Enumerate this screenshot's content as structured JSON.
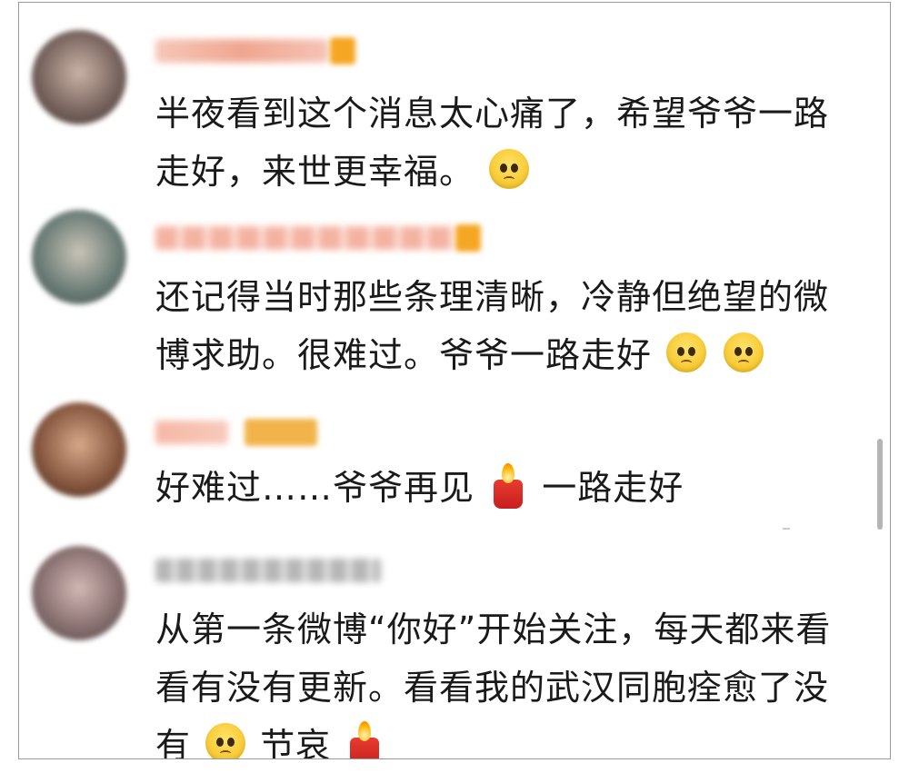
{
  "comments": [
    {
      "avatar_color": "#6b5a55",
      "username_color": "#f3b4a4",
      "text_lines": [
        "半夜看到这个消息太心痛了，希望爷爷一路",
        "走好，来世更幸福。"
      ],
      "trailing_icon": "pleading-face-icon"
    },
    {
      "avatar_color": "#7f8e8a",
      "username_color": "#f2a392",
      "text_lines": [
        "还记得当时那些条理清晰，冷静但绝望的微",
        "博求助。很难过。爷爷一路走好"
      ],
      "trailing_icons": [
        "pleading-face-icon",
        "pleading-face-icon"
      ]
    },
    {
      "avatar_color": "#8a6650",
      "username_color": "#f3a491",
      "text_before": "好难过……爷爷再见",
      "middle_icon": "candle-icon",
      "text_after": "一路走好"
    },
    {
      "avatar_color": "#8a7474",
      "username_color": "#a7a7a7",
      "text_lines": [
        "从第一条微博“你好”开始关注，每天都来看",
        "看有没有更新。看看我的武汉同胞痊愈了没"
      ],
      "last_line_prefix": "有",
      "last_line_word": "节哀",
      "icons": [
        "pleading-face-icon",
        "candle-icon"
      ]
    }
  ]
}
